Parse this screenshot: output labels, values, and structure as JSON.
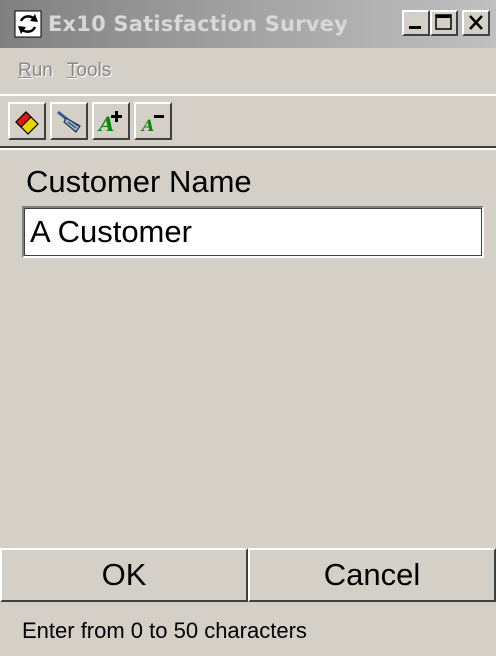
{
  "window": {
    "title": "Ex10 Satisfaction Survey",
    "controls": {
      "minimize_icon": "minimize-icon",
      "maximize_icon": "maximize-icon",
      "close_icon": "close-icon"
    }
  },
  "menu": {
    "items": [
      {
        "label": "Run",
        "accel": "R",
        "rest": "un"
      },
      {
        "label": "Tools",
        "accel": "T",
        "rest": "ools"
      }
    ]
  },
  "toolbar": {
    "buttons": [
      {
        "icon": "eraser-icon"
      },
      {
        "icon": "brush-icon"
      },
      {
        "icon": "font-increase-icon",
        "glyph": "A+"
      },
      {
        "icon": "font-decrease-icon",
        "glyph": "A-"
      }
    ]
  },
  "form": {
    "label": "Customer Name",
    "value": "A Customer"
  },
  "buttons": {
    "ok": "OK",
    "cancel": "Cancel"
  },
  "status": {
    "text": "Enter from 0 to 50 characters"
  },
  "colors": {
    "face": "#d4d0c8",
    "title_gradient_start": "#808080",
    "title_gradient_end": "#c0c0c0",
    "title_text": "#d8d8d8",
    "menu_disabled": "#888888"
  }
}
